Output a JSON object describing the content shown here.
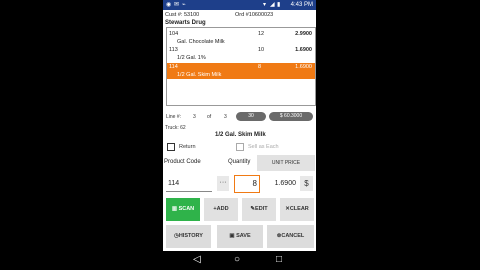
{
  "status_bar": {
    "time": "4:43 PM"
  },
  "order": {
    "cust_label": "Cust #: 53100",
    "ord_label": "Ord #10600023",
    "customer_name": "Stewarts Drug"
  },
  "items": [
    {
      "code": "104",
      "qty": "12",
      "price": "2.9900",
      "desc": "Gal. Chocolate Milk",
      "selected": false
    },
    {
      "code": "113",
      "qty": "10",
      "price": "1.6900",
      "desc": "1/2 Gal. 1%",
      "selected": false
    },
    {
      "code": "114",
      "qty": "8",
      "price": "1.6900",
      "desc": "1/2 Gal. Skim Milk",
      "selected": true
    }
  ],
  "line_info": {
    "line_label": "Line #:",
    "line_num": "3",
    "of_label": "of",
    "total": "3",
    "count_pill": "30",
    "amount_pill": "$ 60.3000"
  },
  "truck": "Truck: 62",
  "selected_desc": "1/2 Gal. Skim Milk",
  "return_label": "Return",
  "sell_each_label": "Sell as Each",
  "product_code_label": "Product Code",
  "quantity_label": "Quantity",
  "unit_price_btn": "UNIT PRICE",
  "product_code_value": "114",
  "dots_label": "···",
  "quantity_value": "8",
  "unit_price_value": "1.6900",
  "dollar_label": "$",
  "buttons": {
    "scan": "SCAN",
    "add": "ADD",
    "edit": "EDIT",
    "clear": "CLEAR",
    "history": "HISTORY",
    "save": "SAVE",
    "cancel": "CANCEL"
  },
  "icons": {
    "scan": "barcode-icon",
    "add": "plus-icon",
    "edit": "pencil-icon",
    "clear": "x-icon",
    "history": "clock-icon",
    "save": "floppy-icon",
    "cancel": "x-circle-icon"
  },
  "colors": {
    "statusbar": "#1e3f8a",
    "selected_row": "#f07a14",
    "scan_button": "#2fb34a",
    "pill": "#6a6a6a"
  }
}
